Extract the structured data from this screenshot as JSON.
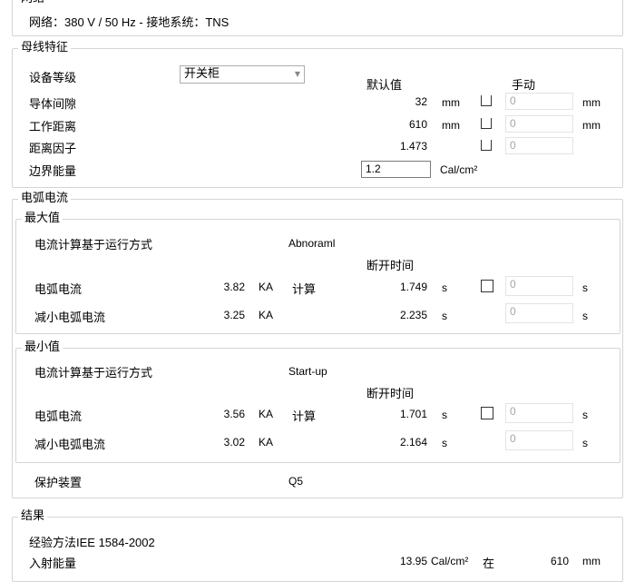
{
  "network": {
    "legend": "网络",
    "info": "网络：380 V / 50 Hz - 接地系统：TNS"
  },
  "busbar": {
    "legend": "母线特征",
    "equipment_label": "设备等级",
    "equipment_value": "开关柜",
    "col_default": "默认值",
    "col_manual": "手动",
    "gap_label": "导体间隙",
    "gap_default": "32",
    "gap_unit": "mm",
    "gap_manual": "0",
    "gap_manual_unit": "mm",
    "dist_label": "工作距离",
    "dist_default": "610",
    "dist_unit": "mm",
    "dist_manual": "0",
    "dist_manual_unit": "mm",
    "factor_label": "距离因子",
    "factor_default": "1.473",
    "factor_manual": "0",
    "boundary_label": "边界能量",
    "boundary_value": "1.2",
    "boundary_unit": "Cal/cm²"
  },
  "arc": {
    "legend": "电弧电流",
    "max": {
      "legend": "最大值",
      "basis_label": "电流计算基于运行方式",
      "basis_value": "Abnoraml",
      "open_time_label": "断开时间",
      "arc_label": "电弧电流",
      "arc_value": "3.82",
      "arc_unit": "KA",
      "calc_label": "计算",
      "arc_time": "1.749",
      "arc_time_unit": "s",
      "arc_manual": "0",
      "arc_manual_unit": "s",
      "reduced_label": "减小电弧电流",
      "reduced_value": "3.25",
      "reduced_unit": "KA",
      "reduced_time": "2.235",
      "reduced_time_unit": "s",
      "reduced_manual": "0",
      "reduced_manual_unit": "s"
    },
    "min": {
      "legend": "最小值",
      "basis_label": "电流计算基于运行方式",
      "basis_value": "Start-up",
      "open_time_label": "断开时间",
      "arc_label": "电弧电流",
      "arc_value": "3.56",
      "arc_unit": "KA",
      "calc_label": "计算",
      "arc_time": "1.701",
      "arc_time_unit": "s",
      "arc_manual": "0",
      "arc_manual_unit": "s",
      "reduced_label": "减小电弧电流",
      "reduced_value": "3.02",
      "reduced_unit": "KA",
      "reduced_time": "2.164",
      "reduced_time_unit": "s",
      "reduced_manual": "0",
      "reduced_manual_unit": "s"
    },
    "protection_label": "保护装置",
    "protection_value": "Q5"
  },
  "result": {
    "legend": "结果",
    "method": "经验方法IEE 1584-2002",
    "incident_label": "入射能量",
    "incident_value": "13.95",
    "incident_unit": "Cal/cm²",
    "at_label": "在",
    "at_value": "610",
    "at_unit": "mm"
  }
}
